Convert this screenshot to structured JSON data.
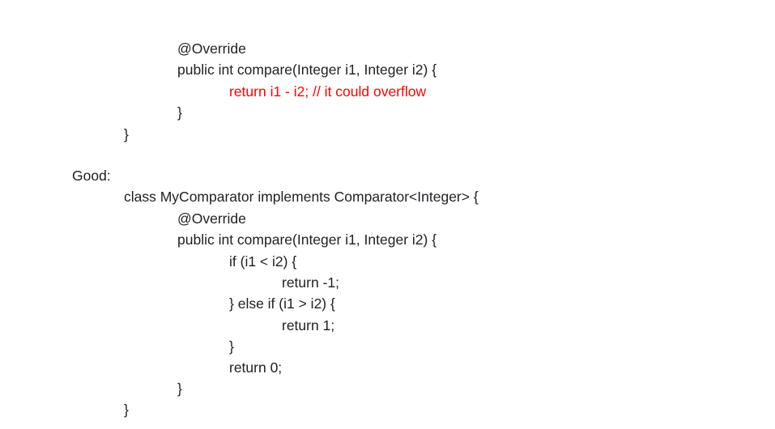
{
  "document": {
    "bad_tail": [
      "@Override",
      "public int compare(Integer i1, Integer i2) {",
      "return i1 - i2; // it could overflow",
      "}",
      "}"
    ],
    "good_label": "Good:",
    "good_code": [
      "class MyComparator implements Comparator<Integer> {",
      "@Override",
      "public int compare(Integer i1, Integer i2) {",
      "if (i1 < i2) {",
      "return -1;",
      "} else if (i1 > i2) {",
      "return 1;",
      "}",
      "return 0;",
      "}",
      "}"
    ],
    "highlight_color": "#ff0000"
  }
}
